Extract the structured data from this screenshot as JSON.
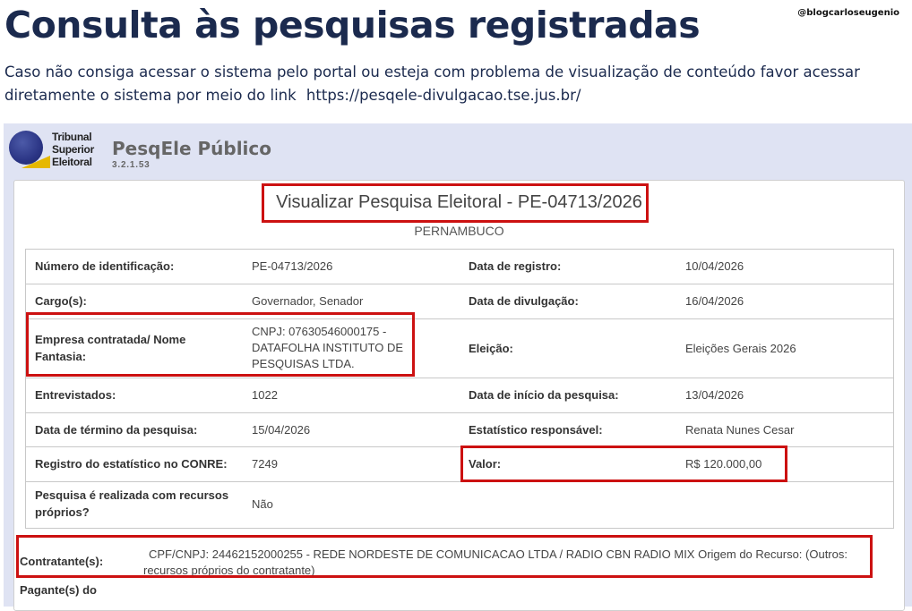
{
  "page": {
    "title": "Consulta às pesquisas registradas",
    "watermark": "@blogcarloseugenio",
    "intro_text": "Caso não consiga acessar o sistema pelo portal ou esteja com problema de visualização de conteúdo favor acessar diretamente o sistema por meio do link",
    "link_text": "https://pesqele-divulgacao.tse.jus.br/"
  },
  "app": {
    "logo_line1": "Tribunal",
    "logo_line2": "Superior",
    "logo_line3": "Eleitoral",
    "name": "PesqEle Público",
    "version": "3.2.1.53"
  },
  "panel": {
    "title": "Visualizar Pesquisa Eleitoral - PE-04713/2026",
    "state": "PERNAMBUCO"
  },
  "details": {
    "rows": [
      {
        "k1": "Número de identificação:",
        "v1": "PE-04713/2026",
        "k2": "Data de registro:",
        "v2": "10/04/2026"
      },
      {
        "k1": "Cargo(s):",
        "v1": "Governador, Senador",
        "k2": "Data de divulgação:",
        "v2": "16/04/2026"
      },
      {
        "k1": "Empresa contratada/ Nome Fantasia:",
        "v1": "CNPJ: 07630546000175 - DATAFOLHA INSTITUTO DE PESQUISAS LTDA.",
        "k2": "Eleição:",
        "v2": "Eleições Gerais 2026"
      },
      {
        "k1": "Entrevistados:",
        "v1": "1022",
        "k2": "Data de início da pesquisa:",
        "v2": "13/04/2026"
      },
      {
        "k1": "Data de término da pesquisa:",
        "v1": "15/04/2026",
        "k2": "Estatístico responsável:",
        "v2": "Renata Nunes Cesar"
      },
      {
        "k1": "Registro do estatístico no CONRE:",
        "v1": "7249",
        "k2": "Valor:",
        "v2": "R$ 120.000,00"
      },
      {
        "k1": "Pesquisa é realizada com recursos próprios?",
        "v1": "Não",
        "k2": "",
        "v2": ""
      }
    ]
  },
  "contratante": {
    "label": "Contratante(s):",
    "value_line1": "CPF/CNPJ: 24462152000255 - REDE NORDESTE DE COMUNICACAO LTDA / RADIO CBN RADIO MIX Origem do Recurso: (Outros:",
    "value_line2": "recursos próprios do contratante)"
  },
  "next_label": "Pagante(s) do",
  "colors": {
    "title": "#1b2a4e",
    "header_bg": "#dfe3f3",
    "highlight": "#cc1111"
  }
}
